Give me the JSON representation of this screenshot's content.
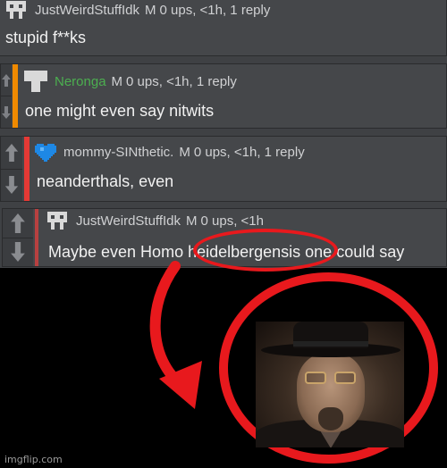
{
  "comments": [
    {
      "username": "JustWeirdStuffIdk",
      "badge": "M",
      "meta": "0 ups, <1h, 1 reply",
      "text": "stupid f**ks",
      "avatar": "pixel-robot-icon",
      "username_color": "#d0d1d3"
    },
    {
      "username": "Neronga",
      "badge": "M",
      "meta": "0 ups, <1h, 1 reply",
      "text": "one might even say nitwits",
      "avatar": "pixel-robot-icon",
      "username_color": "#4caf50",
      "bar_color": "#f08a00"
    },
    {
      "username": "mommy-SINthetic.",
      "badge": "M",
      "meta": "0 ups, <1h, 1 reply",
      "text": "neanderthals, even",
      "avatar": "pixel-heart-icon",
      "bar_color": "#e53935"
    },
    {
      "username": "JustWeirdStuffIdk",
      "badge": "M",
      "meta": "0 ups, <1h",
      "text": "Maybe even Homo heidelbergensis one could say",
      "avatar": "pixel-robot-icon",
      "bar_color": "#b84040"
    }
  ],
  "watermark": "imgflip.com",
  "colors": {
    "highlight_circle": "#e8191d",
    "comment_bg": "#45474a"
  }
}
